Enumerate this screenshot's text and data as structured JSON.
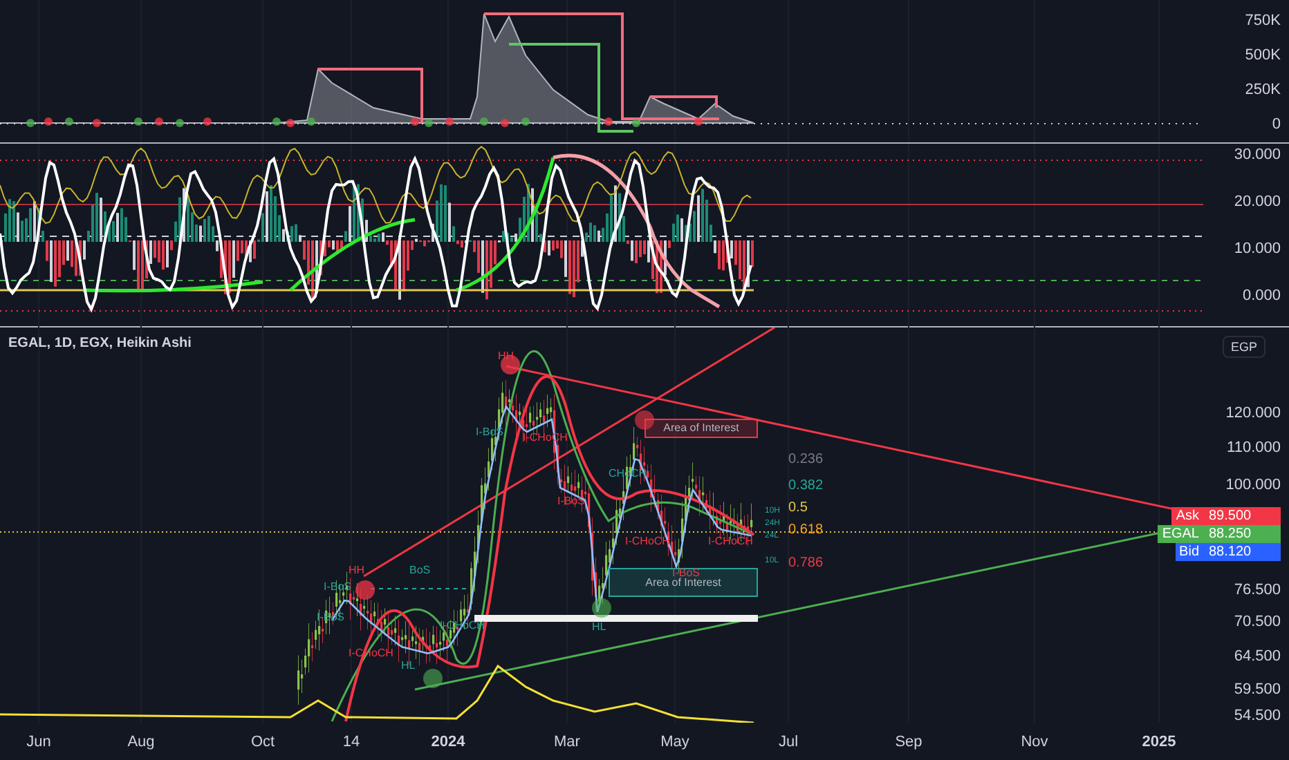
{
  "volume_pane": {
    "axis_labels": [
      "750K",
      "500K",
      "250K",
      "0"
    ]
  },
  "oscillator_pane": {
    "axis_labels": [
      "30.000",
      "20.000",
      "10.000",
      "0.000"
    ]
  },
  "main_pane": {
    "title": "EGAL, 1D, EGX, Heikin Ashi",
    "currency": "EGP",
    "axis_labels": [
      "120.000",
      "110.000",
      "100.000",
      "76.500",
      "70.500",
      "64.500",
      "59.500",
      "54.500"
    ],
    "price_tags": [
      {
        "label": "Ask",
        "value": "89.500",
        "color": "#f23645"
      },
      {
        "label": "EGAL",
        "value": "88.250",
        "color": "#4caf50"
      },
      {
        "label": "Bid",
        "value": "88.120",
        "color": "#2962ff"
      }
    ],
    "fib_levels": [
      {
        "ratio": "0.236",
        "color": "#787b86"
      },
      {
        "ratio": "0.382",
        "color": "#26a69a"
      },
      {
        "ratio": "0.5",
        "color": "#e3c84a"
      },
      {
        "ratio": "0.618",
        "color": "#f7a21b"
      },
      {
        "ratio": "0.786",
        "color": "#f23645"
      }
    ],
    "level_markers": [
      "10H",
      "24H",
      "24L",
      "10L"
    ],
    "zones": [
      {
        "text": "Area of Interest",
        "color": "#f23645"
      },
      {
        "text": "Area of Interest",
        "color": "#26a69a"
      }
    ],
    "annotations": [
      {
        "text": "HH",
        "color": "#f23645"
      },
      {
        "text": "HH",
        "color": "#f23645"
      },
      {
        "text": "BoS",
        "color": "#26a69a"
      },
      {
        "text": "I-BoS",
        "color": "#26a69a"
      },
      {
        "text": "I-BoS",
        "color": "#26a69a"
      },
      {
        "text": "I-CHoCH",
        "color": "#f23645"
      },
      {
        "text": "I-CHoCH",
        "color": "#26a69a"
      },
      {
        "text": "HL",
        "color": "#26a69a"
      },
      {
        "text": "I-BoS",
        "color": "#26a69a"
      },
      {
        "text": "I-CHoCH",
        "color": "#f23645"
      },
      {
        "text": "I-BoS",
        "color": "#f23645"
      },
      {
        "text": "HL",
        "color": "#26a69a"
      },
      {
        "text": "CHoCH",
        "color": "#26a69a"
      },
      {
        "text": "I-CHoCH",
        "color": "#f23645"
      },
      {
        "text": "I-CHoCH",
        "color": "#f23645"
      },
      {
        "text": "I-BoS",
        "color": "#f23645"
      }
    ]
  },
  "time_axis": [
    {
      "label": "Jun",
      "major": false
    },
    {
      "label": "Aug",
      "major": false
    },
    {
      "label": "Oct",
      "major": false
    },
    {
      "label": "14",
      "major": false
    },
    {
      "label": "2024",
      "major": true
    },
    {
      "label": "Mar",
      "major": false
    },
    {
      "label": "May",
      "major": false
    },
    {
      "label": "Jul",
      "major": false
    },
    {
      "label": "Sep",
      "major": false
    },
    {
      "label": "Nov",
      "major": false
    },
    {
      "label": "2025",
      "major": true
    }
  ]
}
